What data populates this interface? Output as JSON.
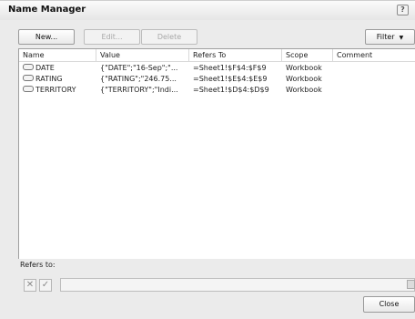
{
  "window": {
    "title": "Name Manager",
    "help": "?"
  },
  "toolbar": {
    "new_label": "New...",
    "edit_label": "Edit...",
    "delete_label": "Delete",
    "filter_label": "Filter",
    "filter_arrow": "▼"
  },
  "table": {
    "columns": [
      "Name",
      "Value",
      "Refers To",
      "Scope",
      "Comment"
    ],
    "rows": [
      {
        "name": "DATE",
        "value": "{\"DATE\";\"16-Sep\";\"...",
        "refers_to": "=Sheet1!$F$4:$F$9",
        "scope": "Workbook",
        "comment": ""
      },
      {
        "name": "RATING",
        "value": "{\"RATING\";\"246.75...",
        "refers_to": "=Sheet1!$E$4:$E$9",
        "scope": "Workbook",
        "comment": ""
      },
      {
        "name": "TERRITORY",
        "value": "{\"TERRITORY\";\"Indi...",
        "refers_to": "=Sheet1!$D$4:$D$9",
        "scope": "Workbook",
        "comment": ""
      }
    ]
  },
  "refers_to": {
    "label": "Refers to:",
    "cancel_glyph": "✕",
    "confirm_glyph": "✓",
    "value": ""
  },
  "footer": {
    "close_label": "Close"
  }
}
